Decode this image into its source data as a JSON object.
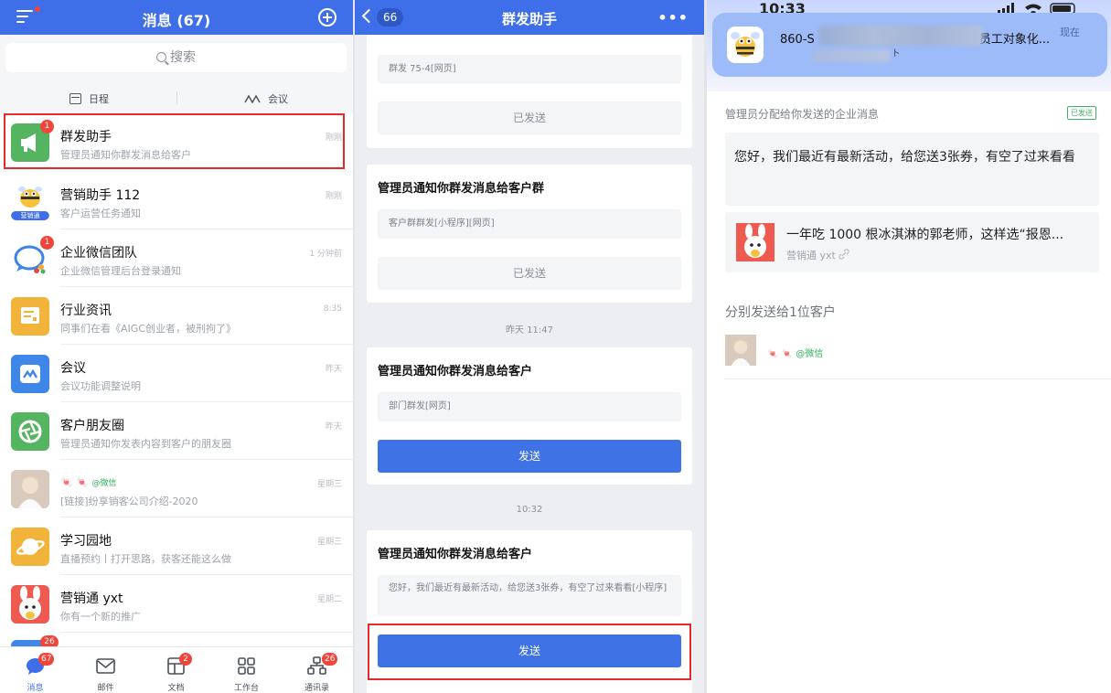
{
  "panel1": {
    "title": "消息 (67)",
    "search_placeholder": "搜索",
    "quick": {
      "schedule": "日程",
      "meeting": "会议"
    },
    "rows": [
      {
        "name": "群发助手",
        "preview": "管理员通知你群发消息给客户",
        "time": "刚刚",
        "badge": "1",
        "icon": "megaphone-icon"
      },
      {
        "name": "营销助手 112",
        "preview": "客户运营任务通知",
        "time": "刚刚",
        "badge": "",
        "tag": "营销通",
        "icon": "bee-mascot-icon"
      },
      {
        "name": "企业微信团队",
        "preview": "企业微信管理后台登录通知",
        "time": "1 分钟前",
        "badge": "1",
        "icon": "chat-bubble-icon"
      },
      {
        "name": "行业资讯",
        "preview": "同事们在看《AIGC创业者，被刑拘了》",
        "time": "8:35",
        "badge": "",
        "icon": "news-icon"
      },
      {
        "name": "会议",
        "preview": "会议功能调整说明",
        "time": "昨天",
        "badge": "",
        "icon": "meeting-icon"
      },
      {
        "name": "客户朋友圈",
        "preview": "管理员通知你发表内容到客户的朋友圈",
        "time": "昨天",
        "badge": "",
        "icon": "moments-aperture-icon"
      },
      {
        "name": "🍬 🍬",
        "suffix": "@微信",
        "preview": "[链接]纷享销客公司介绍-2020",
        "time": "星期三",
        "badge": "",
        "icon": "user-avatar"
      },
      {
        "name": "学习园地",
        "preview": "直播预约丨打开思路，获客还能这么做",
        "time": "星期三",
        "badge": "",
        "icon": "planet-icon"
      },
      {
        "name": "营销通 yxt",
        "preview": "你有一个新的推广",
        "time": "星期二",
        "badge": "",
        "icon": "bunny-mascot-icon"
      }
    ],
    "tabs": [
      {
        "label": "消息",
        "badge": "67",
        "icon": "chat-tab-icon"
      },
      {
        "label": "邮件",
        "badge": "",
        "icon": "mail-icon"
      },
      {
        "label": "文档",
        "badge": "2",
        "icon": "doc-icon"
      },
      {
        "label": "工作台",
        "badge": "",
        "icon": "grid-icon"
      },
      {
        "label": "通讯录",
        "badge": "26",
        "icon": "contacts-icon"
      }
    ],
    "hidden_badge": "26"
  },
  "panel2": {
    "back_count": "66",
    "title": "群发助手",
    "more": "•••",
    "cards": [
      {
        "title": "",
        "body": "群发 75-4[网页]",
        "button": "已发送"
      },
      {
        "title": "管理员通知你群发消息给客户群",
        "body": "客户群群发[小程序][网页]",
        "button": "已发送"
      },
      {
        "title": "管理员通知你群发消息给客户",
        "body": "部门群发[网页]",
        "button": "发送"
      },
      {
        "title": "管理员通知你群发消息给客户",
        "body": "您好，我们最近有最新活动，给您送3张券，有空了过来看看[小程序]",
        "button": "发送"
      }
    ],
    "timestamps": [
      "昨天 11:47",
      "10:32"
    ]
  },
  "panel3": {
    "status_time": "10:33",
    "notification": {
      "title_prefix": "860-S",
      "title_suffix": "员工对象化...",
      "body_fragment": "卜",
      "time": "现在"
    },
    "admin_label": "管理员分配给你发送的企业消息",
    "sent_tag": "已发送",
    "message": "您好，我们最近有最新活动，给您送3张券，有空了过来看看",
    "mini_program": {
      "title": "一年吃 1000 根冰淇淋的郭老师，这样选“报恩...",
      "source": "营销通 yxt"
    },
    "split_label": "分别发送给1位客户",
    "recipient": {
      "name": "🍬 🍬",
      "suffix": "@微信"
    }
  }
}
